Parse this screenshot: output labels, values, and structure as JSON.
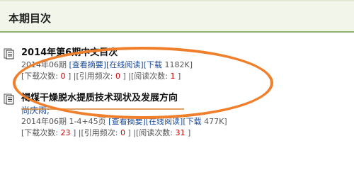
{
  "header": {
    "title": "本期目次"
  },
  "items": [
    {
      "title": "2014年第6期中文目次",
      "author": "",
      "meta": {
        "date": "2014年06期",
        "view_summary": "[查看摘要]",
        "online_read": "[在线阅读]",
        "download": "[下载",
        "size": "1182K]"
      },
      "stats": {
        "downloads_label": "[下载次数:",
        "downloads": "0",
        "citations_label": "]  |[引用频次:",
        "citations": "0",
        "reads_label": "]  |[阅读次数:",
        "reads": "1",
        "end": "]"
      }
    },
    {
      "title": "褐煤干燥脱水提质技术现状及发展方向",
      "author": "尚庆雨;",
      "meta": {
        "date": "2014年06期 1-4+45页",
        "view_summary": "[查看摘要]",
        "online_read": "[在线阅读]",
        "download": "[下载",
        "size": "477K]"
      },
      "stats": {
        "downloads_label": "[下载次数:",
        "downloads": "23",
        "citations_label": "]  |[引用频次:",
        "citations": "0",
        "reads_label": "]  |[阅读次数:",
        "reads": "31",
        "end": "]"
      }
    }
  ],
  "colors": {
    "header_bg": "#f1f5ea",
    "header_border": "#8fb36f",
    "link": "#1a4d9e",
    "count": "#cc0000",
    "annotation": "#f07f2b"
  }
}
